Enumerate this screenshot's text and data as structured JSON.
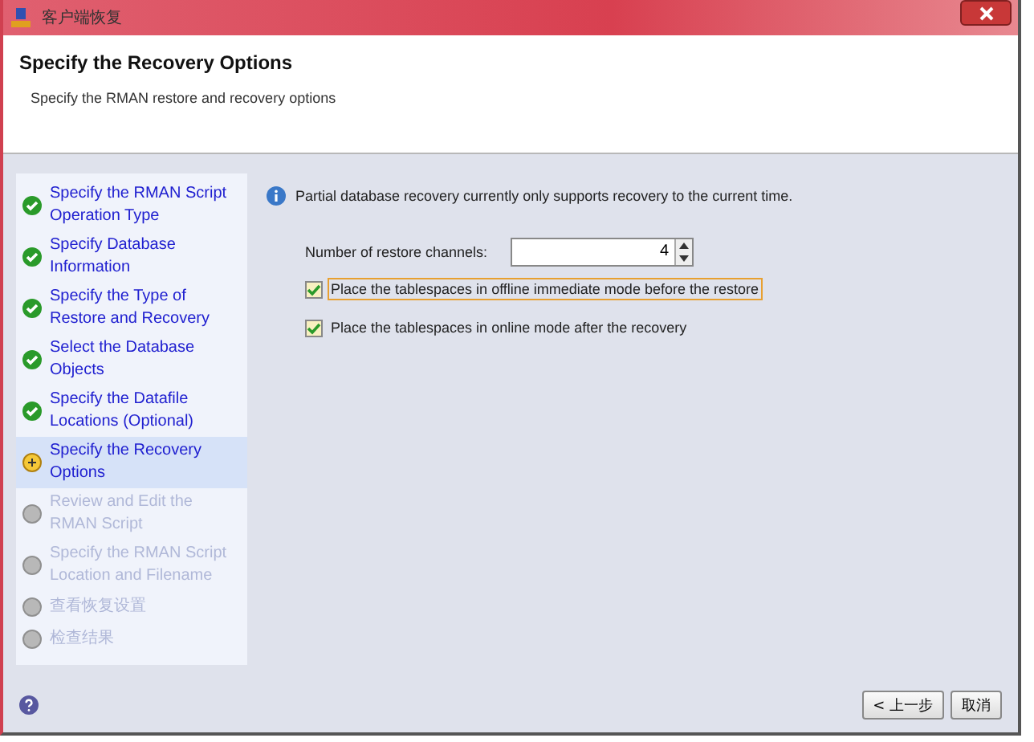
{
  "window": {
    "title": "客户端恢复"
  },
  "header": {
    "title": "Specify the Recovery Options",
    "subtitle": "Specify the RMAN restore and recovery options"
  },
  "steps": [
    {
      "label": "Specify the RMAN Script Operation Type",
      "kind": "done",
      "selected": false
    },
    {
      "label": "Specify Database Information",
      "kind": "done",
      "selected": false
    },
    {
      "label": "Specify the Type of Restore and Recovery",
      "kind": "done",
      "selected": false
    },
    {
      "label": "Select the Database Objects",
      "kind": "done",
      "selected": false
    },
    {
      "label": "Specify the Datafile Locations (Optional)",
      "kind": "done",
      "selected": false
    },
    {
      "label": "Specify the Recovery Options",
      "kind": "current",
      "selected": true
    },
    {
      "label": "Review and Edit the RMAN Script",
      "kind": "pending",
      "selected": false
    },
    {
      "label": "Specify the RMAN Script Location and Filename",
      "kind": "pending",
      "selected": false
    },
    {
      "label": "查看恢复设置",
      "kind": "pending",
      "selected": false
    },
    {
      "label": "检查结果",
      "kind": "pending",
      "selected": false
    }
  ],
  "info": "Partial database recovery currently only supports recovery to the current time.",
  "channels": {
    "label": "Number of restore channels:",
    "value": "4"
  },
  "options": [
    {
      "label": "Place the tablespaces in offline immediate mode before the restore",
      "checked": true,
      "focused": true
    },
    {
      "label": "Place the tablespaces in online mode after the recovery",
      "checked": true,
      "focused": false
    }
  ],
  "buttons": [
    "< 上一步",
    "取消"
  ]
}
